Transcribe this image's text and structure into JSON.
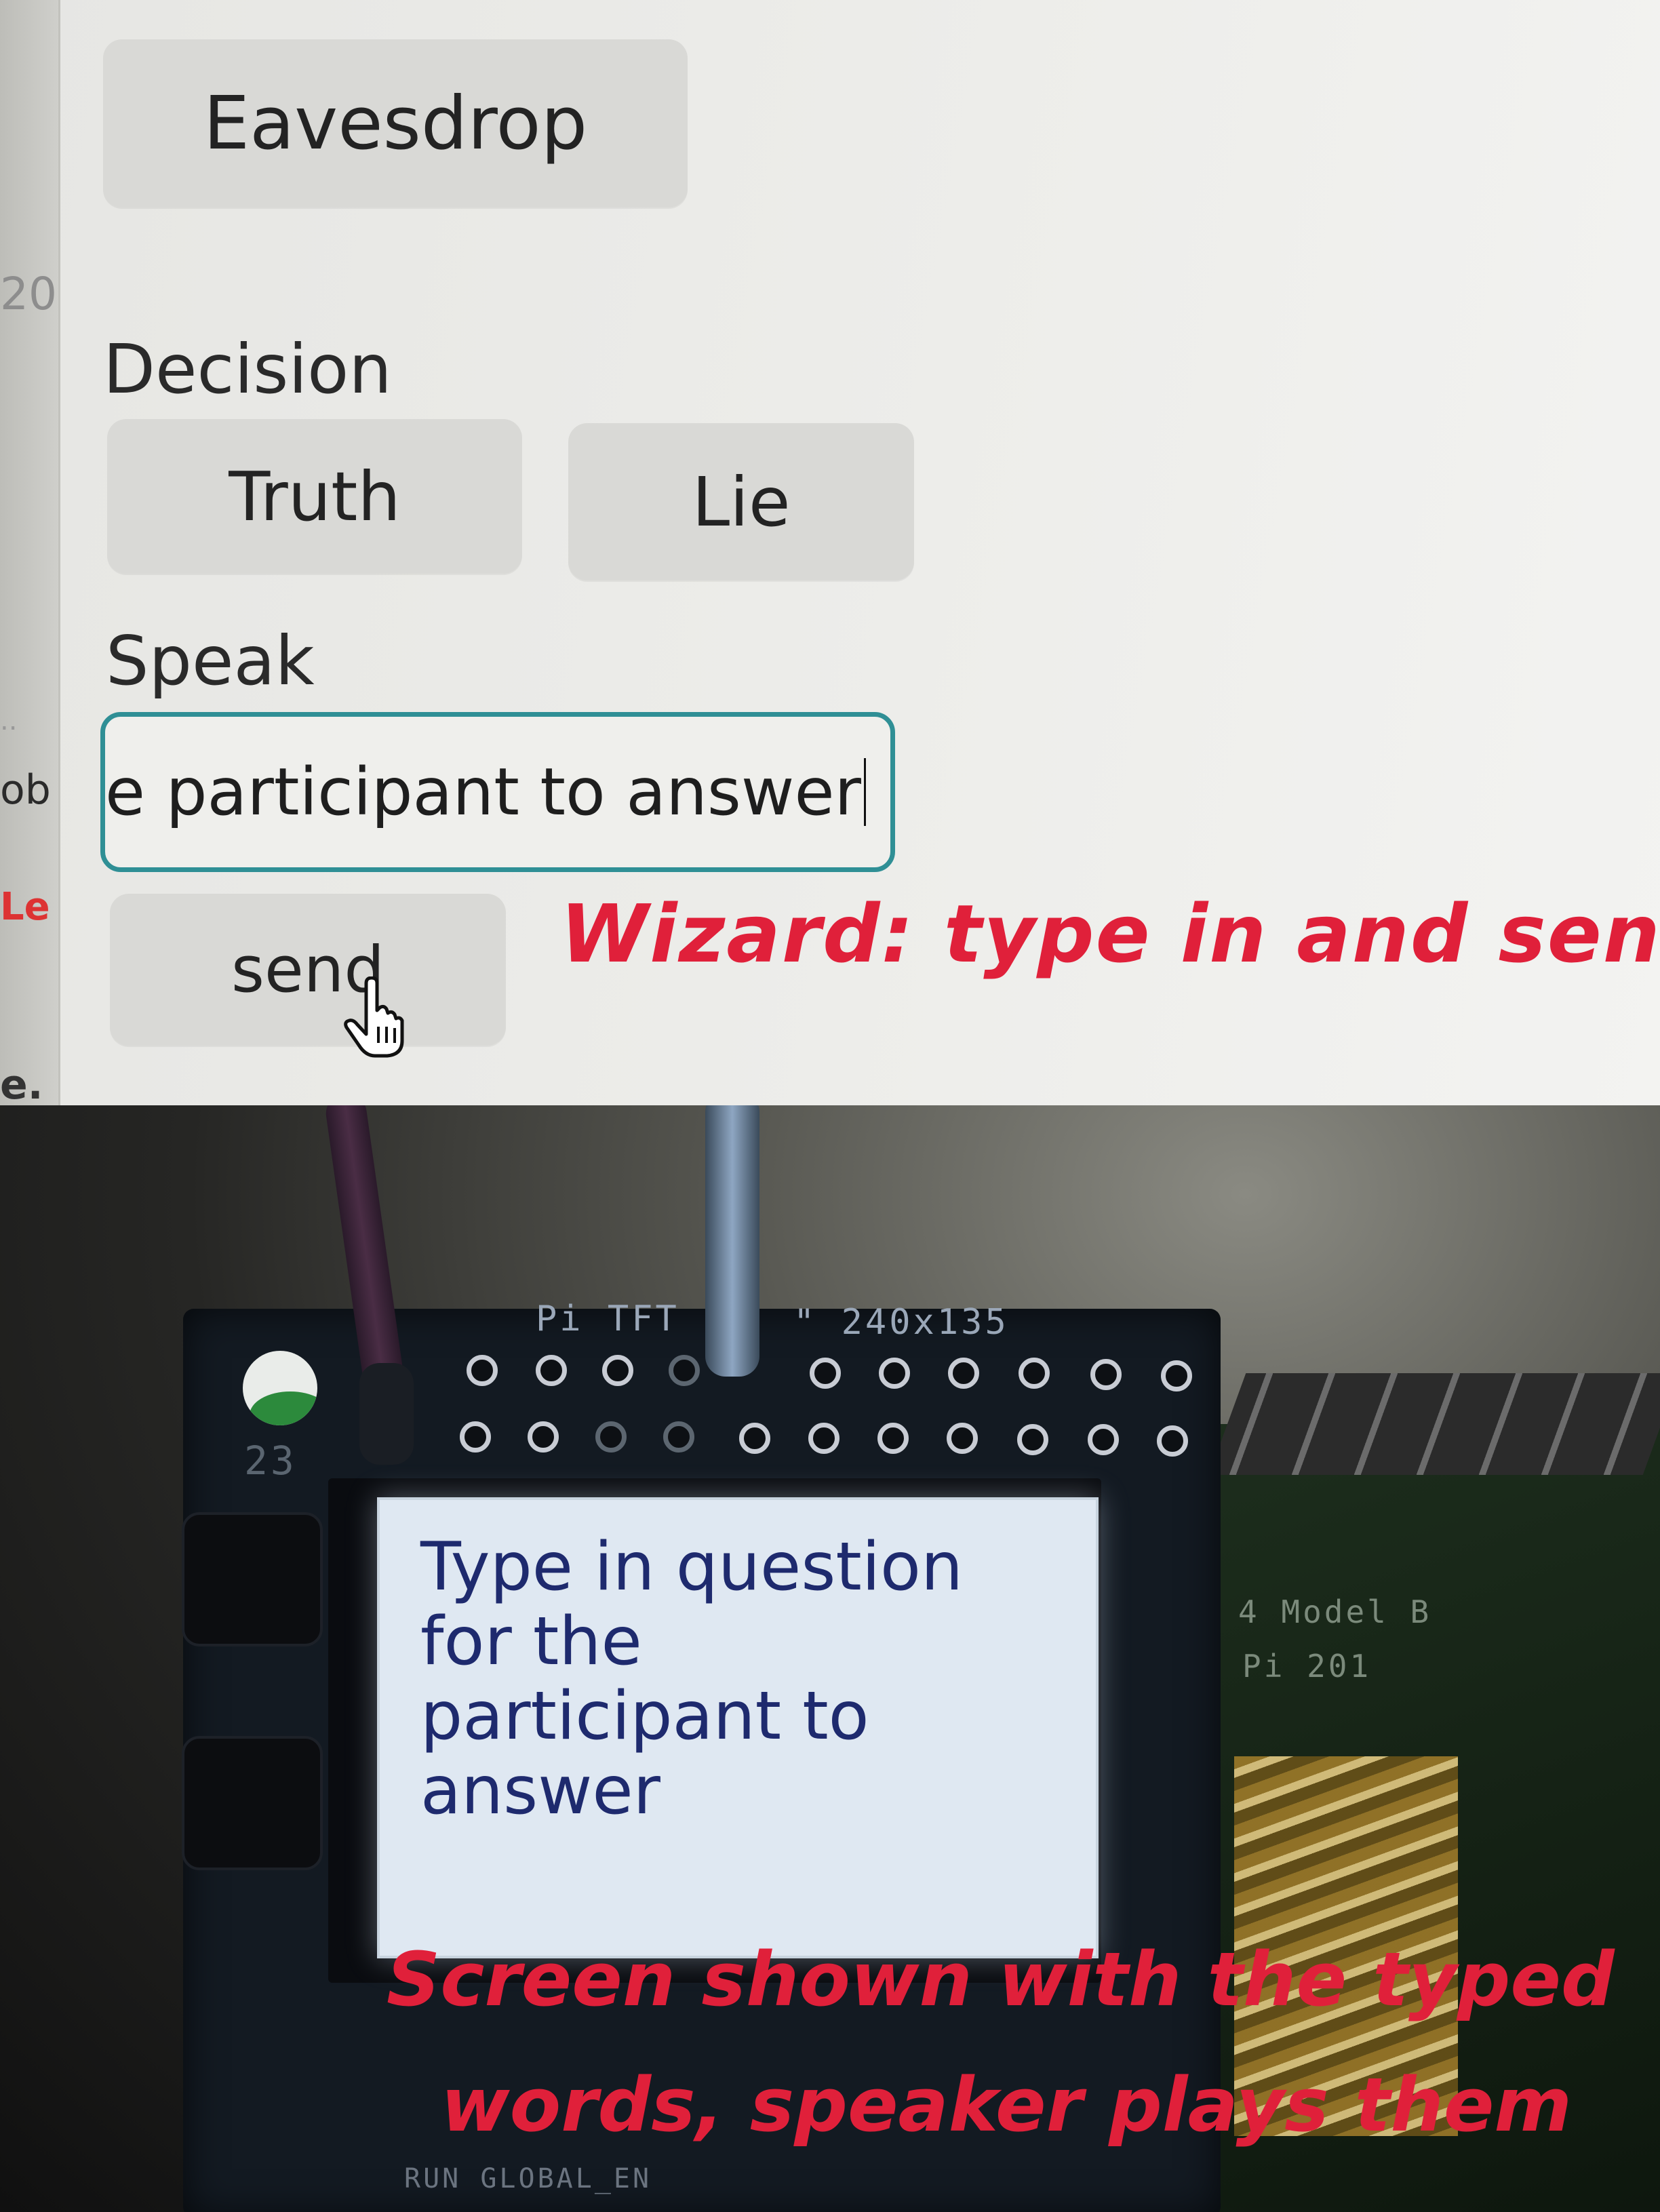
{
  "sidebar_fragments": {
    "year": "20",
    "ellipsis": "..",
    "ob": "ob",
    "le": "Le",
    "dot": "e."
  },
  "controls": {
    "eavesdrop_label": "Eavesdrop",
    "decision_heading": "Decision",
    "truth_label": "Truth",
    "lie_label": "Lie",
    "speak_heading": "Speak",
    "speak_input_value": "e participant to answer",
    "send_label": "send"
  },
  "annotations": {
    "wizard": "Wizard: type in and send",
    "screen_line1": "Screen shown with the typed",
    "screen_line2": "words, speaker plays them"
  },
  "device": {
    "silkscreen_pitft": "Pi TFT",
    "silkscreen_resolution": "\" 240x135",
    "silkscreen_pin": "23",
    "silkscreen_model": "4 Model B",
    "silkscreen_pi": "Pi 201",
    "silkscreen_run": "RUN  GLOBAL_EN",
    "lcd_lines": [
      "Type in question",
      "for the",
      "participant to",
      "answer"
    ]
  },
  "colors": {
    "annotation_red": "#e0203a",
    "input_border_teal": "#2f8f95",
    "lcd_text_blue": "#1e2a6e"
  }
}
